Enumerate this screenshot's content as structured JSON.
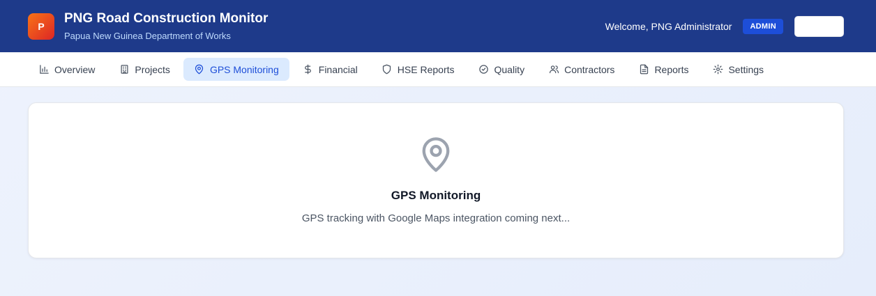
{
  "header": {
    "logo_letter": "P",
    "title": "PNG Road Construction Monitor",
    "subtitle": "Papua New Guinea Department of Works",
    "welcome": "Welcome, PNG Administrator",
    "role_badge": "ADMIN",
    "brand_color": "#1e3a8a"
  },
  "nav": {
    "items": [
      {
        "label": "Overview",
        "icon": "bar-chart-icon"
      },
      {
        "label": "Projects",
        "icon": "building-icon"
      },
      {
        "label": "GPS Monitoring",
        "icon": "map-pin-icon",
        "active": true
      },
      {
        "label": "Financial",
        "icon": "dollar-icon"
      },
      {
        "label": "HSE Reports",
        "icon": "shield-icon"
      },
      {
        "label": "Quality",
        "icon": "check-circle-icon"
      },
      {
        "label": "Contractors",
        "icon": "users-icon"
      },
      {
        "label": "Reports",
        "icon": "file-text-icon"
      },
      {
        "label": "Settings",
        "icon": "gear-icon"
      }
    ],
    "active_color": "#dbeafe"
  },
  "main": {
    "placeholder_icon": "map-pin-icon",
    "title": "GPS Monitoring",
    "message": "GPS tracking with Google Maps integration coming next..."
  }
}
